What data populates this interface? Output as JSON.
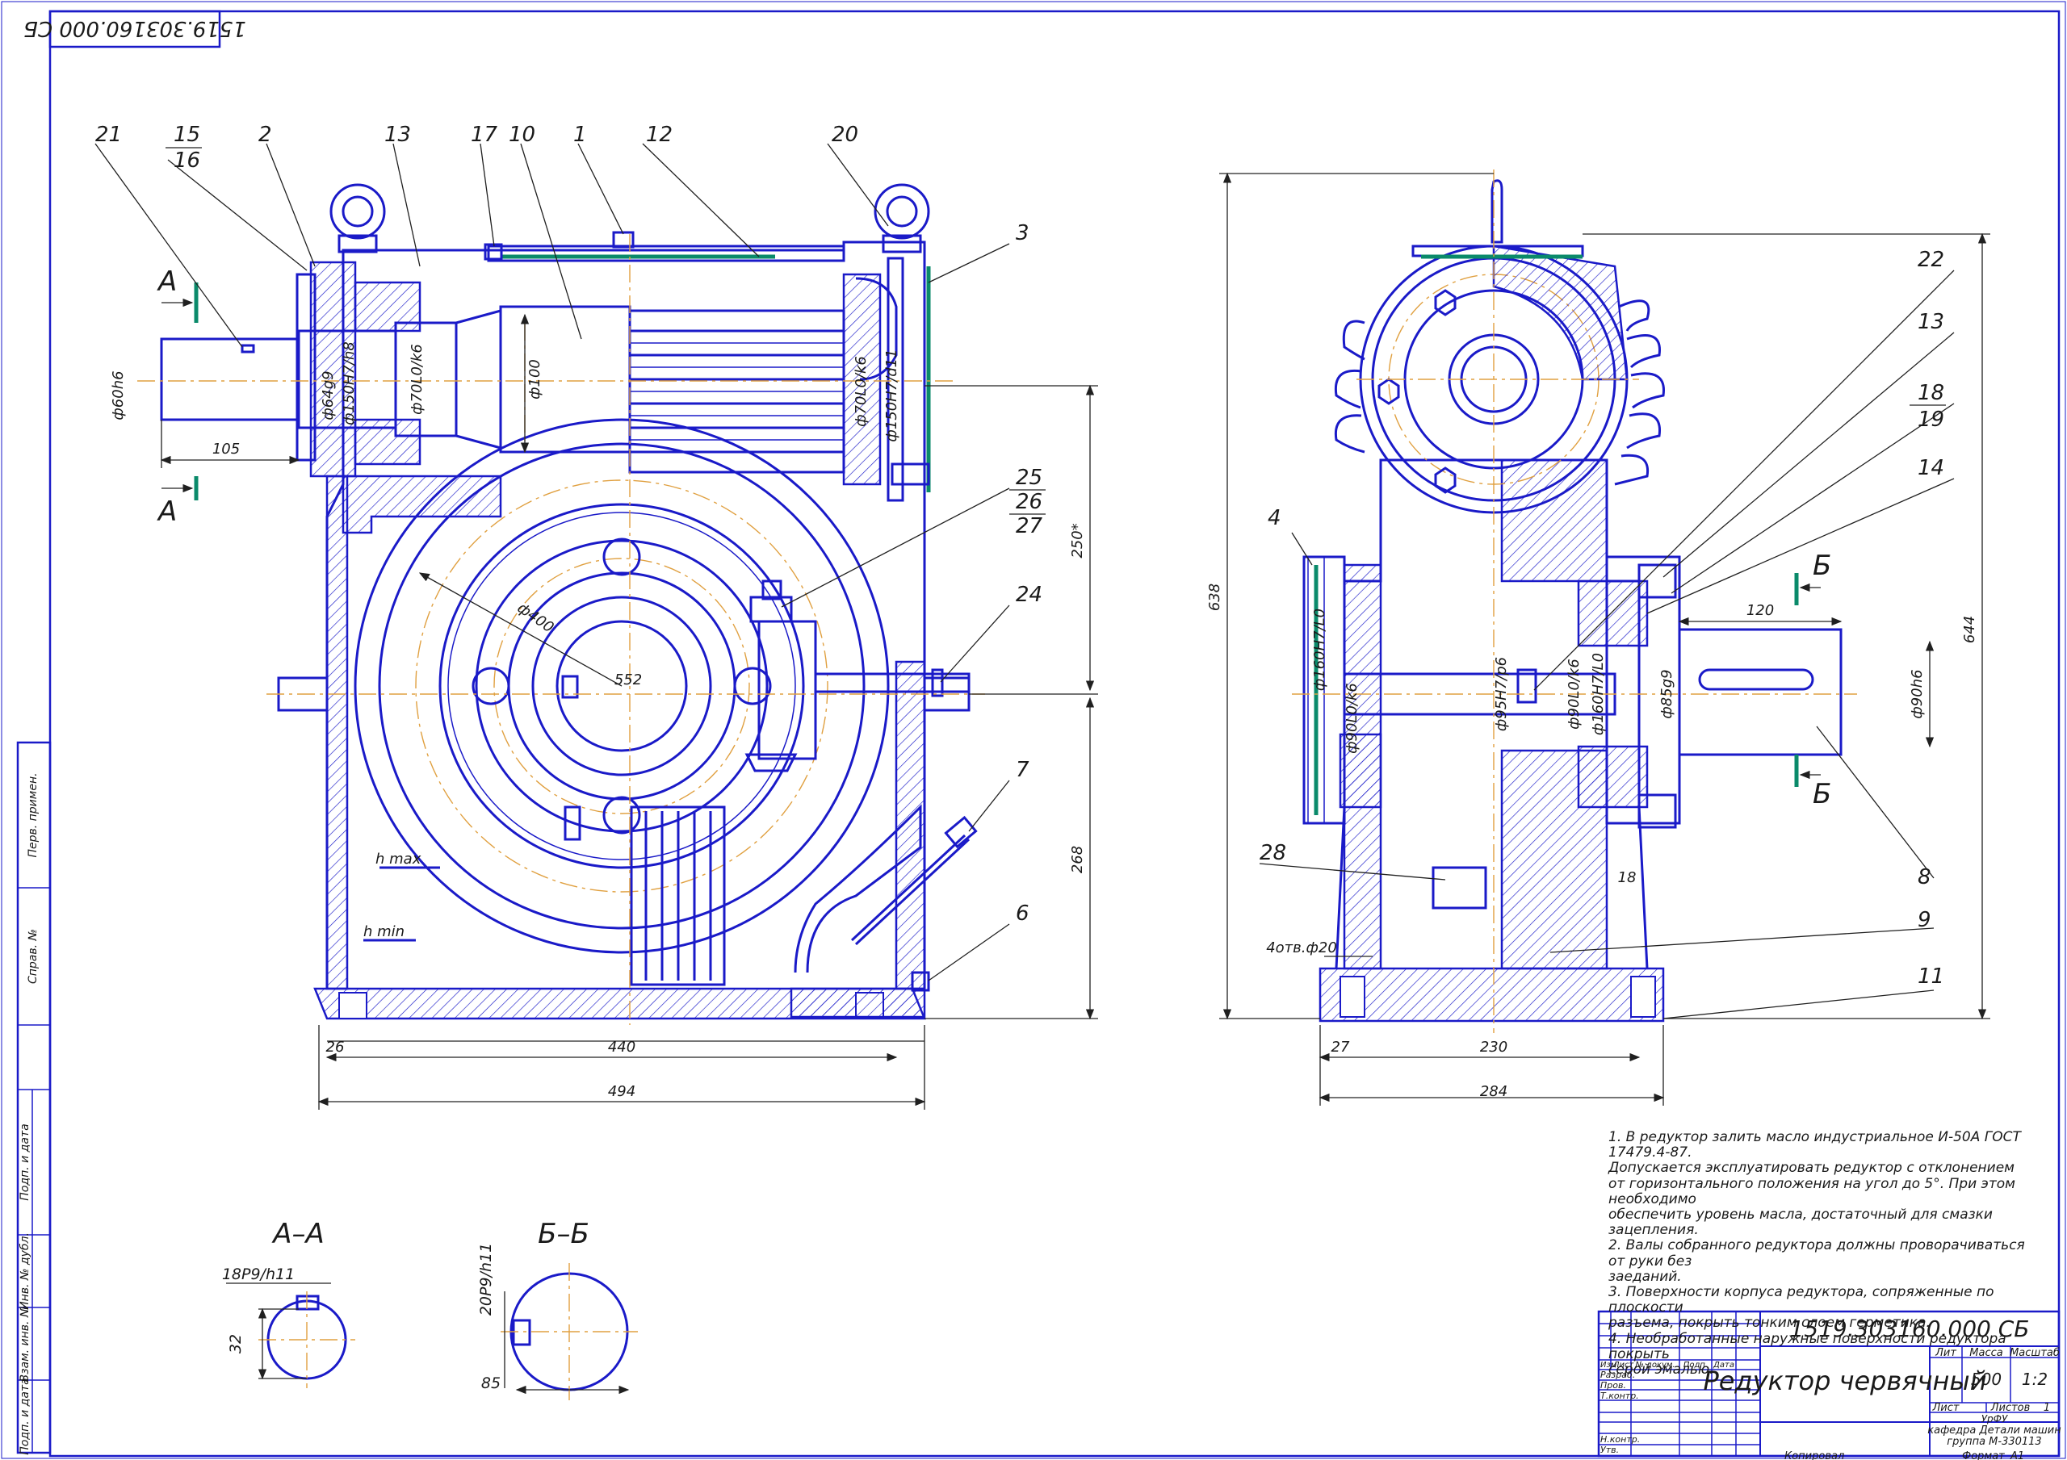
{
  "designation_stamp": "1519.303160.000 СБ",
  "position_labels": [
    "21",
    "15",
    "16",
    "2",
    "13",
    "17",
    "10",
    "1",
    "12",
    "20",
    "3",
    "25",
    "26",
    "27",
    "24",
    "7",
    "6",
    "22",
    "13",
    "18",
    "19",
    "14",
    "4",
    "8",
    "28",
    "9",
    "11"
  ],
  "dimensions": {
    "left_view": [
      "ф60h6",
      "ф64g9",
      "ф150H7/h8",
      "ф70L0/k6",
      "ф100",
      "ф70L0/k6",
      "ф150H7/d11",
      "105",
      "ф400",
      "552",
      "250*",
      "268",
      "26",
      "440",
      "494"
    ],
    "right_view": [
      "638",
      "644",
      "120",
      "ф90h6",
      "ф95H7/p6",
      "ф90L0/k6",
      "ф160H7/L0",
      "ф85g9",
      "ф160H7/L0",
      "ф90L0/k6",
      "18",
      "4отв.ф20",
      "27",
      "230",
      "284"
    ],
    "level_marks": [
      "h max",
      "h min"
    ]
  },
  "section_marks": {
    "a": "А",
    "b": "Б"
  },
  "section_aa": {
    "title": "А–А",
    "key": "18P9/h11",
    "depth": "32"
  },
  "section_bb": {
    "title": "Б–Б",
    "key": "20P9/h11",
    "depth": "85"
  },
  "notes": [
    "1. В редуктор залить масло индустриальное И-50А ГОСТ 17479.4-87.",
    "Допускается эксплуатировать редуктор с отклонением",
    "от горизонтального положения на угол до 5°. При этом необходимо",
    "обеспечить уровень масла, достаточный для смазки зацепления.",
    "2. Валы собранного редуктора должны проворачиваться от руки без",
    "заеданий.",
    "3. Поверхности корпуса редуктора, сопряженные по плоскости",
    "разъема, покрыть тонким слоем герметика.",
    "4. Необработанные наружные поверхности  редуктора покрыть",
    "серой эмалью."
  ],
  "title_block": {
    "designation": "1519.303160.000 СБ",
    "name": "Редуктор червячный",
    "lit_header": "Лит",
    "mass_header": "Масса",
    "scale_header": "Масштаб",
    "mass": "500",
    "scale": "1:2",
    "sheet_label": "Лист",
    "sheets_label": "Листов",
    "sheets_value": "1",
    "org_line1": "УрФУ",
    "org_line2": "кафедра Детали машин",
    "org_line3": "группа М-330113",
    "row_labels": [
      "Изм",
      "Лист",
      "№ докум.",
      "Подп.",
      "Дата"
    ],
    "roles": [
      "Разраб.",
      "Пров.",
      "Т.контр.",
      "",
      "Н.контр.",
      "Утв."
    ],
    "copied": "Копировал",
    "format_label": "Формат",
    "format_value": "А1"
  },
  "side_stamp": [
    "Перв. примен.",
    "Справ. №",
    "Подп. и дата",
    "Инв. № дубл.",
    "Взам. инв. №",
    "Подп. и дата",
    "Инв. № подл."
  ]
}
